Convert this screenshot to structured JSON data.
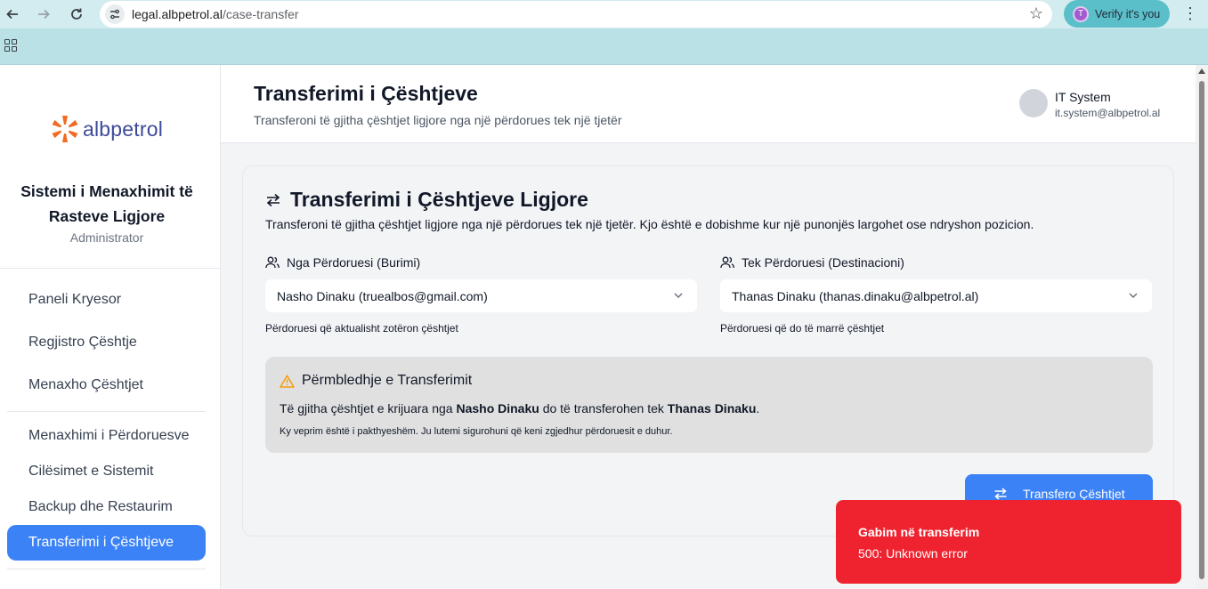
{
  "browser": {
    "url_host": "legal.albpetrol.al",
    "url_path": "/case-transfer",
    "verify_label": "Verify it's you",
    "profile_initial": "T"
  },
  "sidebar": {
    "logo_text": "albpetrol",
    "system_title": "Sistemi i Menaxhimit të Rasteve Ligjore",
    "role": "Administrator",
    "items": [
      {
        "label": "Paneli Kryesor"
      },
      {
        "label": "Regjistro Çështje"
      },
      {
        "label": "Menaxho Çështjet"
      },
      {
        "label": "Menaxhimi i Përdoruesve"
      },
      {
        "label": "Cilësimet e Sistemit"
      },
      {
        "label": "Backup dhe Restaurim"
      },
      {
        "label": "Transferimi i Çështjeve",
        "active": true
      }
    ]
  },
  "header": {
    "title": "Transferimi i Çështjeve",
    "subtitle": "Transferoni të gjitha çështjet ligjore nga një përdorues tek një tjetër",
    "user_name": "IT System",
    "user_email": "it.system@albpetrol.al"
  },
  "card": {
    "title": "Transferimi i Çështjeve Ligjore",
    "description": "Transferoni të gjitha çështjet ligjore nga një përdorues tek një tjetër. Kjo është e dobishme kur një punonjës largohet ose ndryshon pozicion.",
    "from": {
      "label": "Nga Përdoruesi (Burimi)",
      "value": "Nasho Dinaku (truealbos@gmail.com)",
      "hint": "Përdoruesi që aktualisht zotëron çështjet"
    },
    "to": {
      "label": "Tek Përdoruesi (Destinacioni)",
      "value": "Thanas Dinaku (thanas.dinaku@albpetrol.al)",
      "hint": "Përdoruesi që do të marrë çështjet"
    },
    "summary": {
      "title": "Përmbledhje e Transferimit",
      "line_prefix": "Të gjitha çështjet e krijuara nga",
      "from_name": "Nasho Dinaku",
      "line_middle": "do të transferohen tek",
      "to_name": "Thanas Dinaku",
      "line_suffix": ".",
      "note": "Ky veprim është i pakthyeshëm. Ju lutemi sigurohuni që keni zgjedhur përdoruesit e duhur."
    },
    "transfer_button": "Transfero Çështjet"
  },
  "toast": {
    "title": "Gabim në transferim",
    "message": "500: Unknown error"
  },
  "colors": {
    "accent": "#3b82f6",
    "error": "#ef232f",
    "warning": "#f59e0b"
  }
}
